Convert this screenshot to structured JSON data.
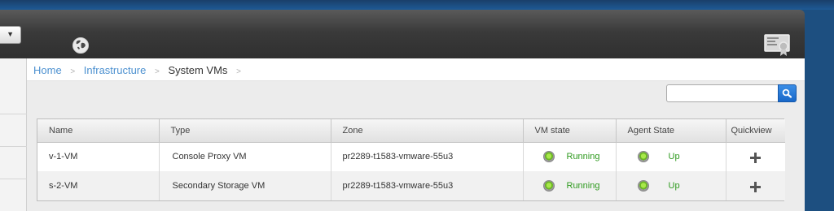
{
  "header": {
    "select_arrow": "▼",
    "globe_icon": "globe-icon",
    "certificate_icon": "certificate-icon"
  },
  "breadcrumb": {
    "items": [
      "Home",
      "Infrastructure",
      "System VMs"
    ],
    "separator": ">"
  },
  "search": {
    "value": "",
    "placeholder": ""
  },
  "table": {
    "columns": [
      "Name",
      "Type",
      "Zone",
      "VM state",
      "Agent State",
      "Quickview"
    ],
    "rows": [
      {
        "name": "v-1-VM",
        "type": "Console Proxy VM",
        "zone": "pr2289-t1583-vmware-55u3",
        "vm_state": "Running",
        "agent_state": "Up"
      },
      {
        "name": "s-2-VM",
        "type": "Secondary Storage VM",
        "zone": "pr2289-t1583-vmware-55u3",
        "vm_state": "Running",
        "agent_state": "Up"
      }
    ]
  },
  "colors": {
    "link": "#4d91d0",
    "state_running": "#2e9a1e",
    "header_dark": "#3a3a3a",
    "search_button": "#1868c9"
  }
}
